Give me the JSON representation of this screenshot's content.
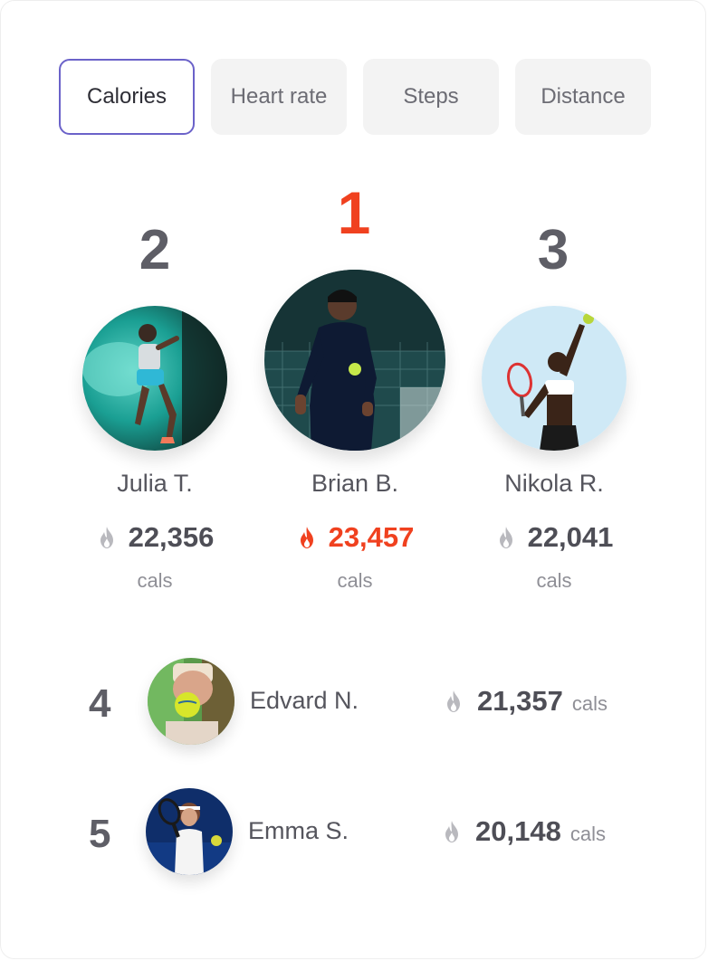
{
  "tabs": [
    {
      "label": "Calories",
      "active": true
    },
    {
      "label": "Heart rate",
      "active": false
    },
    {
      "label": "Steps",
      "active": false
    },
    {
      "label": "Distance",
      "active": false
    }
  ],
  "podium": {
    "first": {
      "rank": "1",
      "name": "Brian B.",
      "value": "23,457",
      "unit": "cals"
    },
    "second": {
      "rank": "2",
      "name": "Julia T.",
      "value": "22,356",
      "unit": "cals"
    },
    "third": {
      "rank": "3",
      "name": "Nikola R.",
      "value": "22,041",
      "unit": "cals"
    }
  },
  "list": [
    {
      "rank": "4",
      "name": "Edvard N.",
      "value": "21,357",
      "unit": "cals"
    },
    {
      "rank": "5",
      "name": "Emma S.",
      "value": "20,148",
      "unit": "cals"
    }
  ],
  "colors": {
    "accent": "#6b62c9",
    "leader": "#f0411f",
    "text": "#4e4e56",
    "muted": "#8f8f96",
    "flame_gray": "#b9b9be"
  },
  "icons": {
    "flame": "flame-icon"
  }
}
